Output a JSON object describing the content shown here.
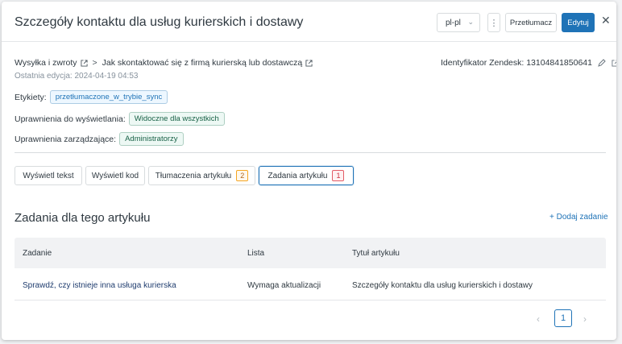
{
  "header": {
    "title": "Szczegóły kontaktu dla usług kurierskich i dostawy",
    "language": "pl-pl",
    "translator_label": "Przetłumacz",
    "edit_label": "Edytuj"
  },
  "breadcrumb": {
    "category": "Wysyłka i zwroty",
    "separator": ">",
    "section": "Jak skontaktować się z firmą kurierską lub dostawczą"
  },
  "last_edit": "Ostatnia edycja: 2024-04-19 04:53",
  "zendesk_id": "Identyfikator Zendesk: 13104841850641",
  "labels": {
    "key": "Etykiety:",
    "value": "przetłumaczone_w_trybie_sync"
  },
  "view_permissions": {
    "key": "Uprawnienia do wyświetlania:",
    "value": "Widoczne dla wszystkich"
  },
  "manage_permissions": {
    "key": "Uprawnienia zarządzające:",
    "value": "Administratorzy"
  },
  "tabs": [
    {
      "label": "Wyświetl tekst"
    },
    {
      "label": "Wyświetl kod"
    },
    {
      "label": "Tłumaczenia artykułu",
      "badge": "2"
    },
    {
      "label": "Zadania artykułu",
      "badge": "1"
    }
  ],
  "section_title": "Zadania dla tego artykułu",
  "add_task_label": "+ Dodaj zadanie",
  "table": {
    "headers": [
      "Zadanie",
      "Lista",
      "Tytuł artykułu"
    ],
    "rows": [
      [
        "Sprawdź, czy istnieje inna usługa kurierska",
        "Wymaga aktualizacji",
        "Szczegóły kontaktu dla usług kurierskich i dostawy"
      ]
    ]
  },
  "pagination": {
    "prev": "‹",
    "current": "1",
    "next": "›"
  },
  "colors": {
    "accent": "#1f73b7",
    "tag_green": "#186146",
    "badge_orange": "#f5a623",
    "badge_red": "#e35b66"
  }
}
